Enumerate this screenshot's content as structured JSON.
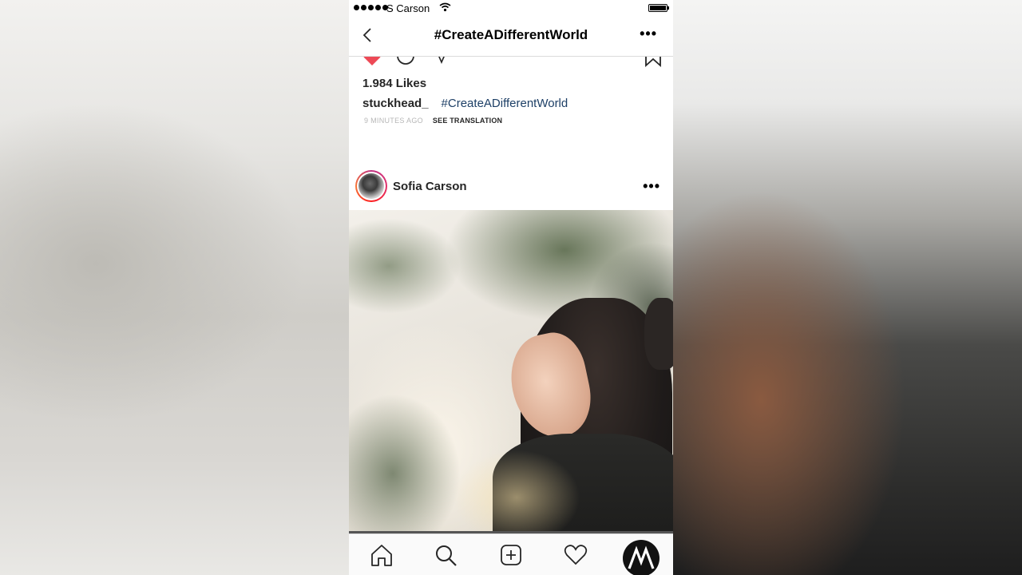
{
  "status_bar": {
    "carrier": "S Carson",
    "signal_icon": "signal-dots-icon",
    "wifi_icon": "wifi-icon",
    "battery_icon": "battery-icon"
  },
  "nav": {
    "title": "#CreateADifferentWorld",
    "back_icon": "back-chevron-icon",
    "more_icon": "more-dots-icon"
  },
  "post_previous": {
    "liked": true,
    "likes": "1.984 Likes",
    "caption_user": "stuckhead_",
    "caption_hashtag": "#CreateADifferentWorld",
    "time": "9 MINUTES AGO",
    "translate": "SEE TRANSLATION"
  },
  "post_current": {
    "username": "Sofia Carson",
    "more_icon": "more-dots-icon"
  },
  "tab_bar": {
    "items": [
      "home-icon",
      "search-icon",
      "add-post-icon",
      "heart-icon",
      "profile-icon"
    ]
  },
  "colors": {
    "like_red": "#ed4956",
    "hashtag": "#1d3f66",
    "avatar_ring": "#e1306c"
  }
}
